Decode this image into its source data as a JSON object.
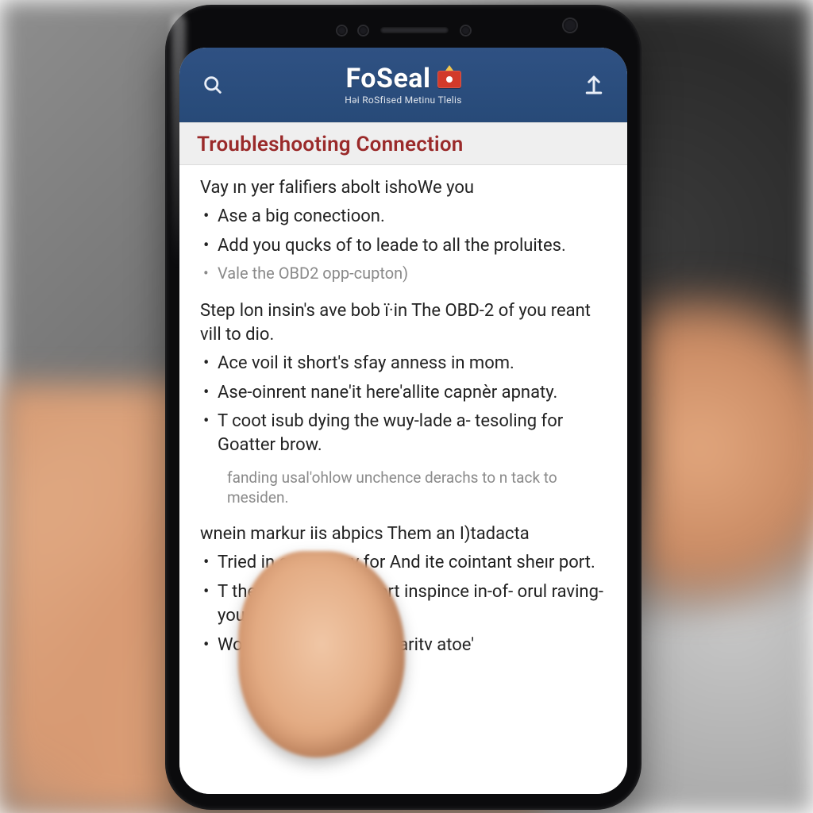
{
  "header": {
    "brand_title": "FoSeal",
    "brand_subtitle": "Həi RoSfised Metinu Tlelis",
    "search_icon_name": "search-icon",
    "upload_icon_name": "upload-icon"
  },
  "section": {
    "title": "Troubleshooting Connection"
  },
  "content": {
    "intro": "Vay ın yer falifiers abolt ishoWe you",
    "intro_bullets": [
      "Ase a big conectioon.",
      "Add you qucks of to leade to all the proluites."
    ],
    "intro_note": "Vale the OBD2 opp-cupton)",
    "step1_text": "Step lon insin's ave bob ї·in The OBD-2 of you reant vill to dio.",
    "step1_bullets": [
      "Ace voil it short's sfay anness in mom.",
      "Ase-oinrent nane'it here'allite capnèr apnaty.",
      "T coot isub dying the wuy-lade a- tesoling for Goatter brow."
    ],
    "step1_note": "fanding usal'ohlow unchence derachs to n tack to mesiden.",
    "step2_text": "wnein markur iis abpics Them an I)tadacta",
    "step2_bullets": [
      "Tried in a stur reyy for And ite cointant sheır port.",
      "T them a loof'valgy port inspince in-of- orul raving-you andi sunes.",
      "Woin and onison or secaritv atoe'"
    ]
  },
  "colors": {
    "header_bg": "#2a4a78",
    "title_color": "#9a2a2a",
    "text": "#222222",
    "muted": "#8a8a8a"
  }
}
